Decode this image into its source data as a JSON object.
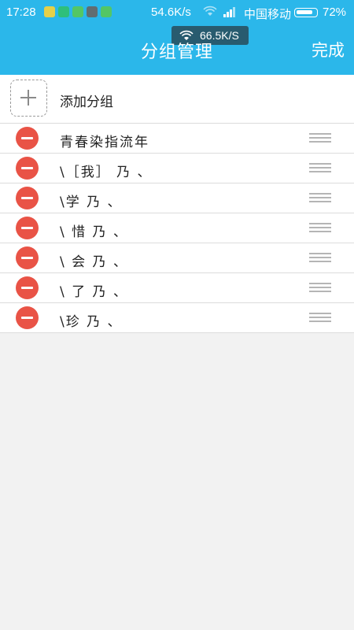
{
  "status_bar": {
    "time": "17:28",
    "speed": "54.6K/s",
    "carrier": "中国移动",
    "battery": "72%",
    "battery_level": 0.72
  },
  "toast": {
    "text": "66.5K/S"
  },
  "header": {
    "title": "分组管理",
    "done_label": "完成",
    "color": "#2bb7ea"
  },
  "add_group": {
    "label": "添加分组"
  },
  "groups": [
    {
      "label": "青春染指流年"
    },
    {
      "label": "\\［我］ 乃 、"
    },
    {
      "label": "\\学 乃 、"
    },
    {
      "label": "\\ 惜 乃 、"
    },
    {
      "label": "\\ 会 乃 、"
    },
    {
      "label": "\\ 了 乃 、"
    },
    {
      "label": "\\珍 乃 、"
    }
  ],
  "colors": {
    "remove": "#e95346",
    "background": "#f2f2f2"
  },
  "icons": {
    "remove": "minus-circle-icon",
    "drag": "drag-handle-icon",
    "add": "plus-icon"
  }
}
